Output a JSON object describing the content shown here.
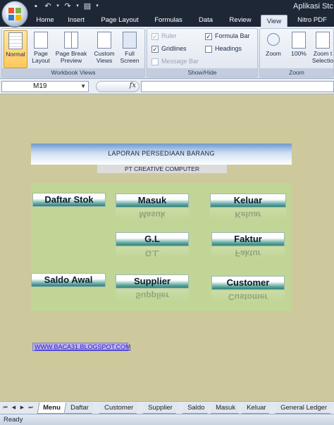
{
  "app": {
    "title": "Aplikasi Stc"
  },
  "ribbon_tabs": [
    "Home",
    "Insert",
    "Page Layout",
    "Formulas",
    "Data",
    "Review",
    "View",
    "Nitro PDF"
  ],
  "active_tab": "View",
  "groups": {
    "workbook_views": {
      "label": "Workbook Views",
      "buttons": [
        "Normal",
        "Page Layout",
        "Page Break Preview",
        "Custom Views",
        "Full Screen"
      ]
    },
    "show_hide": {
      "label": "Show/Hide",
      "ruler": "Ruler",
      "gridlines": "Gridlines",
      "message_bar": "Message Bar",
      "formula_bar": "Formula Bar",
      "headings": "Headings"
    },
    "zoom": {
      "label": "Zoom",
      "buttons": [
        "Zoom",
        "100%",
        "Zoom t Selectio"
      ]
    }
  },
  "checkboxes": {
    "ruler": true,
    "gridlines": true,
    "message_bar": false,
    "formula_bar": true,
    "headings": false
  },
  "formula_bar": {
    "name_box": "M19",
    "fx": "fx",
    "value": ""
  },
  "sheet": {
    "banner_title": "LAPORAN PERSEDIAAN BARANG",
    "company": "PT CREATIVE COMPUTER",
    "buttons": {
      "daftar_stok": "Daftar Stok",
      "masuk": "Masuk",
      "keluar": "Keluar",
      "gl": "G.L",
      "faktur": "Faktur",
      "saldo_awal": "Saldo Awal",
      "supplier": "Supplier",
      "customer": "Customer"
    },
    "link": "WWW.BACA31.BLOGSPOT.COM"
  },
  "sheet_tabs": [
    "Menu",
    "Daftar",
    "Customer",
    "Supplier",
    "Saldo",
    "Masuk",
    "Keluar",
    "General Ledger"
  ],
  "active_sheet": "Menu",
  "status": "Ready",
  "colors": {
    "sheet_bg": "#cdc99d",
    "panel_bg": "#c1d596",
    "button_teal": "#2f7f78",
    "banner_blue": "#6f98d0"
  }
}
